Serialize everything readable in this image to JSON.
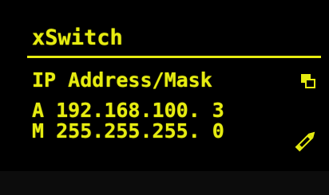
{
  "header": {
    "title": "xSwitch"
  },
  "section": {
    "label": "IP Address/Mask"
  },
  "fields": {
    "address": {
      "prefix": "A",
      "value": "192.168.100. 3"
    },
    "mask": {
      "prefix": "M",
      "value": "255.255.255. 0"
    }
  },
  "icons": {
    "copy": "copy-icon",
    "edit": "pencil-icon"
  },
  "colors": {
    "foreground": "#e6ec10",
    "background": "#000000"
  }
}
